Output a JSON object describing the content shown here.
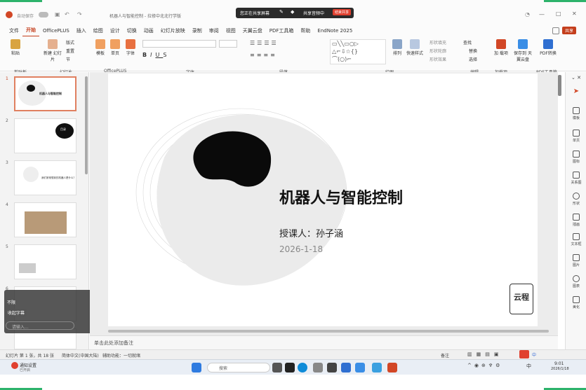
{
  "titlebar": {
    "autosave": "自动保存",
    "file_title": "机器人与智能控制 - 拉修中北北行学版",
    "share_notice": "您正在共享屏幕",
    "sharing": "共享音频中",
    "end_share": "结束共享"
  },
  "menu": [
    "文件",
    "开始",
    "OfficePLUS",
    "插入",
    "绘图",
    "设计",
    "切换",
    "动画",
    "幻灯片放映",
    "录制",
    "审阅",
    "视图",
    "天翼云盘",
    "PDF工具箱",
    "帮助",
    "EndNote 2025"
  ],
  "menu_share": "共享",
  "ribbon": {
    "groups": [
      "剪贴板",
      "幻灯片",
      "OfficePLUS",
      "字体",
      "段落",
      "绘图",
      "编辑",
      "加载项",
      "PDF工具箱"
    ],
    "buttons": {
      "paste": "粘贴",
      "new_slide": "新建\n幻灯片",
      "layout": "版式",
      "reset": "重置",
      "section": "节",
      "template": "模板",
      "single": "单页",
      "font": "字体",
      "arrange": "排列",
      "quick_style": "快速样式",
      "fill": "形状填充",
      "outline": "形状轮廓",
      "effect": "形状效果",
      "find": "查找",
      "replace": "替换",
      "select": "选择",
      "addin": "加\n载项",
      "save_cloud": "保存到\n天翼云盘",
      "pdf_convert": "PDF转换"
    }
  },
  "slides": [
    {
      "num": "1",
      "label": "机器人与智能控制"
    },
    {
      "num": "2",
      "label": "目录"
    },
    {
      "num": "3",
      "label": "我们常常想到的机器人是什么？"
    },
    {
      "num": "4",
      "label": ""
    },
    {
      "num": "5",
      "label": ""
    },
    {
      "num": "6",
      "label": ""
    }
  ],
  "slide": {
    "title": "机器人与智能控制",
    "lecturer": "授课人：孙子涵",
    "date": "2026-1-18",
    "logo": "云程"
  },
  "notes": "单击此处添加备注",
  "status": {
    "slide_count": "幻灯片 第 1 张，共 18 张",
    "language": "简体中文(中国大陆)",
    "accessibility": "辅助功能：一切就绪",
    "notes_btn": "备注",
    "zoom": "中"
  },
  "overlay": {
    "line1": "不限",
    "back": "收起字幕",
    "input_placeholder": "请输入..."
  },
  "rightpanel": [
    "模板",
    "单页",
    "图标",
    "关系图",
    "形状",
    "插画",
    "文本框",
    "图片",
    "图表",
    "美化"
  ],
  "taskbar": {
    "search": "搜索",
    "app_name": "通知设置",
    "app_sub": "已开启",
    "time": "9:01",
    "date": "2026/1/18",
    "lang": "中"
  },
  "colors": {
    "accent": "#c43e1c",
    "share_red": "#e0402f",
    "green_mark": "#2db36b"
  }
}
